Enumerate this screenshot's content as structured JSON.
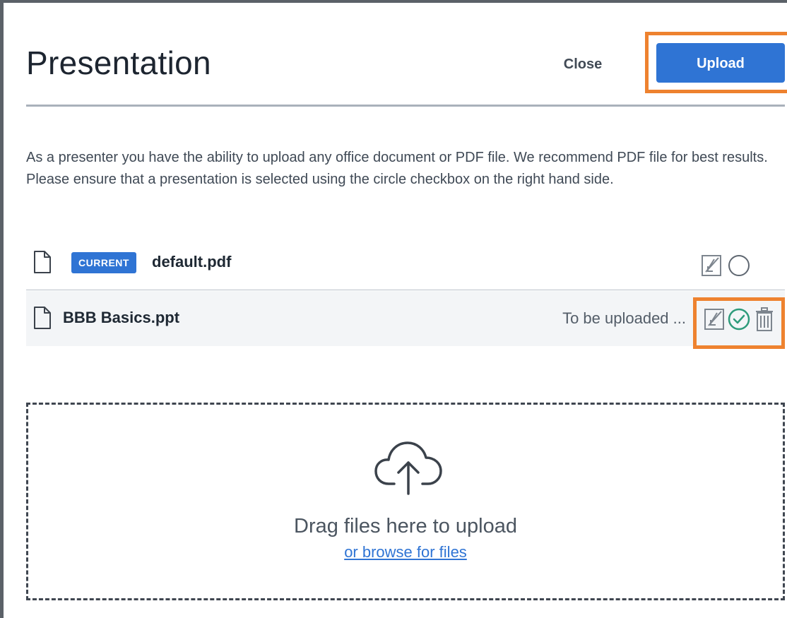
{
  "modal": {
    "title": "Presentation",
    "close_label": "Close",
    "upload_label": "Upload",
    "description": "As a presenter you have the ability to upload any office document or PDF file. We recommend PDF file for best results. Please ensure that a presentation is selected using the circle checkbox on the right hand side."
  },
  "files": [
    {
      "badge": "CURRENT",
      "name": "default.pdf",
      "status": "",
      "icons": [
        "document-icon",
        "download-disabled-icon",
        "radio-unchecked-icon"
      ]
    },
    {
      "badge": "",
      "name": "BBB Basics.ppt",
      "status": "To be uploaded ...",
      "icons": [
        "document-icon",
        "download-disabled-icon",
        "radio-checked-icon",
        "trash-icon"
      ]
    }
  ],
  "dropzone": {
    "icon": "cloud-upload-icon",
    "drag_text": "Drag files here to upload",
    "browse_text": "or browse for files"
  },
  "colors": {
    "accent": "#2f74d4",
    "highlight": "#ee822f",
    "check": "#2e9b7b",
    "text": "#1e2833"
  }
}
